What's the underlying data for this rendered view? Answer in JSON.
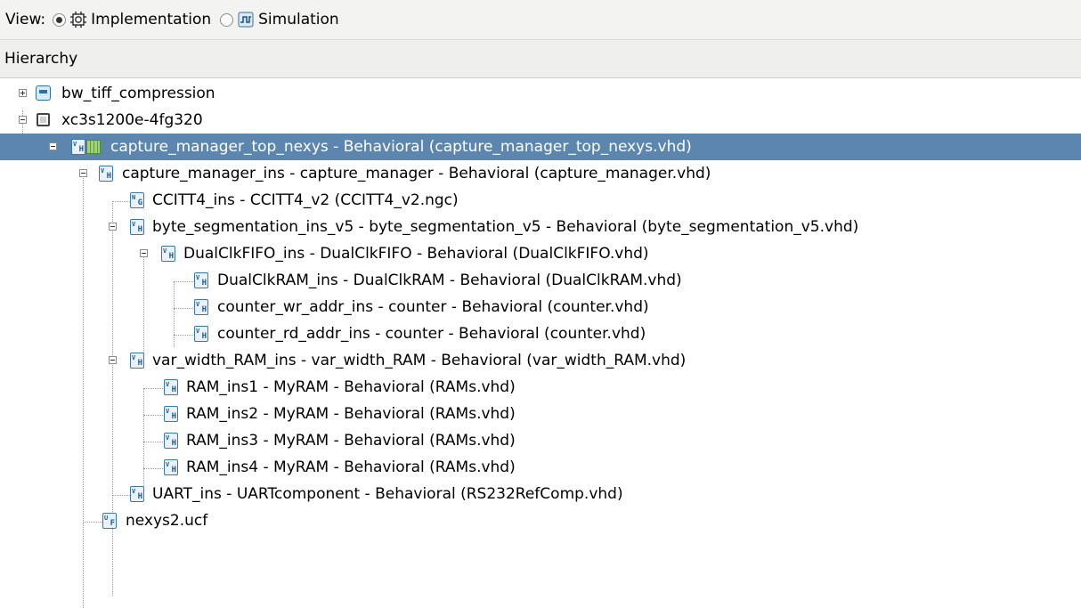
{
  "viewbar": {
    "label": "View:",
    "options": [
      {
        "label": "Implementation",
        "selected": true,
        "icon": "gear-chip-icon"
      },
      {
        "label": "Simulation",
        "selected": false,
        "icon": "waveform-icon"
      }
    ]
  },
  "hierarchy": {
    "header": "Hierarchy",
    "rows": [
      {
        "label": "bw_tiff_compression",
        "icon": "project-icon",
        "expander": "plus"
      },
      {
        "label": "xc3s1200e-4fg320",
        "icon": "chip-icon",
        "expander": "minus"
      },
      {
        "label": "capture_manager_top_nexys - Behavioral (capture_manager_top_nexys.vhd)",
        "icon": "vhdl-top-module-icon",
        "expander": "minus",
        "selected": true
      },
      {
        "label": "capture_manager_ins - capture_manager - Behavioral (capture_manager.vhd)",
        "icon": "vhdl-file-icon",
        "expander": "minus"
      },
      {
        "label": "CCITT4_ins - CCITT4_v2 (CCITT4_v2.ngc)",
        "icon": "netlist-icon",
        "expander": "none"
      },
      {
        "label": "byte_segmentation_ins_v5 - byte_segmentation_v5 - Behavioral (byte_segmentation_v5.vhd)",
        "icon": "vhdl-file-icon",
        "expander": "minus"
      },
      {
        "label": "DualClkFIFO_ins - DualClkFIFO - Behavioral (DualClkFIFO.vhd)",
        "icon": "vhdl-file-icon",
        "expander": "minus"
      },
      {
        "label": "DualClkRAM_ins - DualClkRAM - Behavioral (DualClkRAM.vhd)",
        "icon": "vhdl-file-icon",
        "expander": "none"
      },
      {
        "label": "counter_wr_addr_ins - counter - Behavioral (counter.vhd)",
        "icon": "vhdl-file-icon",
        "expander": "none"
      },
      {
        "label": "counter_rd_addr_ins - counter - Behavioral (counter.vhd)",
        "icon": "vhdl-file-icon",
        "expander": "none"
      },
      {
        "label": "var_width_RAM_ins - var_width_RAM - Behavioral (var_width_RAM.vhd)",
        "icon": "vhdl-file-icon",
        "expander": "minus"
      },
      {
        "label": "RAM_ins1 - MyRAM - Behavioral (RAMs.vhd)",
        "icon": "vhdl-file-icon",
        "expander": "none"
      },
      {
        "label": "RAM_ins2 - MyRAM - Behavioral (RAMs.vhd)",
        "icon": "vhdl-file-icon",
        "expander": "none"
      },
      {
        "label": "RAM_ins3 - MyRAM - Behavioral (RAMs.vhd)",
        "icon": "vhdl-file-icon",
        "expander": "none"
      },
      {
        "label": "RAM_ins4 - MyRAM - Behavioral (RAMs.vhd)",
        "icon": "vhdl-file-icon",
        "expander": "none"
      },
      {
        "label": "UART_ins - UARTcomponent - Behavioral (RS232RefComp.vhd)",
        "icon": "vhdl-file-icon",
        "expander": "none"
      },
      {
        "label": "nexys2.ucf",
        "icon": "constraints-file-icon",
        "expander": "none"
      }
    ]
  },
  "colors": {
    "selection": "#5c86ad",
    "toolbar_bg": "#f3f3f1"
  }
}
